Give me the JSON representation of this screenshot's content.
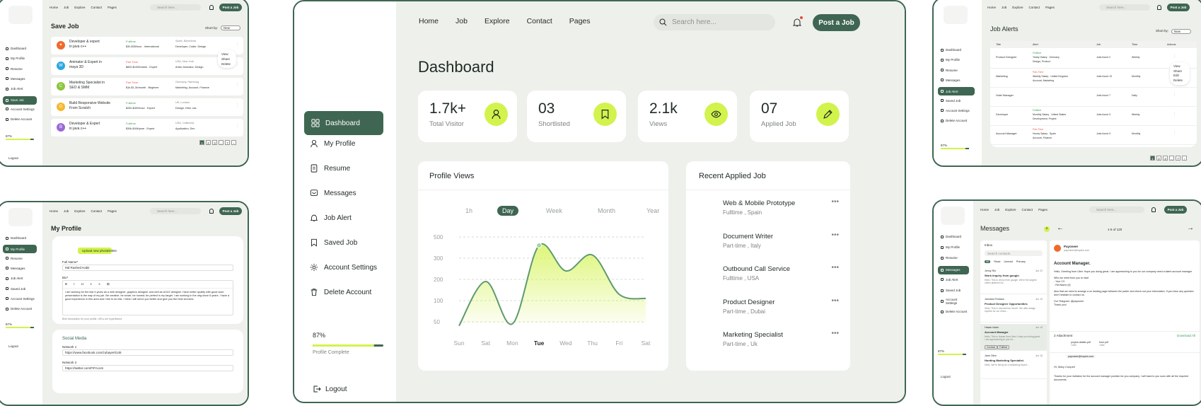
{
  "nav": {
    "home": "Home",
    "job": "Job",
    "explore": "Explore",
    "contact": "Contact",
    "pages": "Pages"
  },
  "search_placeholder": "Search here...",
  "post_job": "Post a Job",
  "center": {
    "title": "Dashboard",
    "sidebar": [
      {
        "label": "Dashboard",
        "icon": "grid-icon"
      },
      {
        "label": "My Profile",
        "icon": "user-icon"
      },
      {
        "label": "Resume",
        "icon": "file-icon"
      },
      {
        "label": "Messages",
        "icon": "chat-icon"
      },
      {
        "label": "Job Alert",
        "icon": "bell-icon"
      },
      {
        "label": "Saved Job",
        "icon": "bookmark-icon"
      },
      {
        "label": "Account Settings",
        "icon": "gear-icon"
      },
      {
        "label": "Delete Account",
        "icon": "trash-icon"
      }
    ],
    "progress": {
      "pct_label": "87%",
      "value": 0.87,
      "label": "Profile Complete"
    },
    "logout": "Logout",
    "stats": [
      {
        "value": "1.7k+",
        "label": "Total Visitor",
        "icon": "user-icon"
      },
      {
        "value": "03",
        "label": "Shortlisted",
        "icon": "bookmark-icon"
      },
      {
        "value": "2.1k",
        "label": "Views",
        "icon": "eye-icon"
      },
      {
        "value": "07",
        "label": "Applied Job",
        "icon": "pencil-icon"
      }
    ],
    "profile_views": {
      "title": "Profile Views",
      "tabs": [
        "1h",
        "Day",
        "Week",
        "Month",
        "Year"
      ],
      "active_tab": "Day"
    },
    "recent": {
      "title": "Recent Applied Job",
      "items": [
        {
          "title": "Web & Mobile Prototype",
          "meta": "Fulltime , Spain"
        },
        {
          "title": "Document Writer",
          "meta": "Part-time , Italy"
        },
        {
          "title": "Outbound Call Service",
          "meta": "Fulltime , USA"
        },
        {
          "title": "Product Designer",
          "meta": "Part-time , Dubai"
        },
        {
          "title": "Marketing Specialist",
          "meta": "Part-time , Uk"
        }
      ]
    }
  },
  "chart_data": {
    "type": "area",
    "categories": [
      "Sun",
      "Sat",
      "Mon",
      "Tue",
      "Wed",
      "Thu",
      "Fri",
      "Sat"
    ],
    "values": [
      30,
      190,
      40,
      420,
      240,
      330,
      130,
      110
    ],
    "yticks": [
      500,
      300,
      200,
      100,
      50
    ],
    "highlight": "Tue",
    "color": "#5e9a6f"
  },
  "save_job": {
    "title": "Save Job",
    "sort_label": "Short by:",
    "sort_value": "New",
    "sidebar": [
      "Dashboard",
      "My Profile",
      "Resume",
      "Messages",
      "Job Alert",
      "Save Job",
      "Account Settings",
      "Delete Account"
    ],
    "active": "Save Job",
    "progress": "87%",
    "progress_value": 0.87,
    "logout": "Logout",
    "rows": [
      {
        "title": "Developer & expert",
        "title2": "in java c++",
        "type": "Fulltime",
        "type_color": "#3fa35a",
        "salary": "$30-$35/hour . International",
        "loc": "Spain, Barcelona",
        "tags": "Developer, Coder, Design",
        "logo_color": "#f06a2a",
        "logo": "✦"
      },
      {
        "title": "Animator & Expert in",
        "title2": "maya 3D",
        "type": "Part Time",
        "type_color": "#e85a4f",
        "salary": "$800-$1000/week . Expert",
        "loc": "USA, New York",
        "tags": "Artist, Animator, Design",
        "logo_color": "#2aa8e0",
        "logo": "W"
      },
      {
        "title": "Marketing Specialist in",
        "title2": "SEO & SMM",
        "type": "Part Time",
        "type_color": "#e85a4f",
        "salary": "$1k-$1.2k/month . Beginner",
        "loc": "Germany, Hamburg",
        "tags": "Marketing, Account, Finance",
        "logo_color": "#8cc63f",
        "logo": "C"
      },
      {
        "title": "Build Responsive Website",
        "title2": "From Scratch",
        "type": "Fulltime",
        "type_color": "#3fa35a",
        "salary": "$260-$400/hour . Expert",
        "loc": "UK, London",
        "tags": "Design, Html, css",
        "logo_color": "#f5b82e",
        "logo": "G"
      },
      {
        "title": "Developer & Expert",
        "title2": "in java c++",
        "type": "Fulltime",
        "type_color": "#3fa35a",
        "salary": "$30k-$40k/year . Expert",
        "loc": "USA, California",
        "tags": "Application, Dev",
        "logo_color": "#9b6ad6",
        "logo": "B"
      }
    ],
    "menu": [
      "View",
      "Share",
      "Delete"
    ],
    "pages": [
      "1",
      "2",
      "3",
      "...",
      "7",
      "›"
    ]
  },
  "my_profile": {
    "title": "My Profile",
    "sidebar": [
      "Dashboard",
      "My Profile",
      "Resume",
      "Messages",
      "Job Alert",
      "Saved Job",
      "Account Settings",
      "Delete Account"
    ],
    "active": "My Profile",
    "upload": "Upload new photo",
    "delete": "Delete",
    "full_name_label": "Full Name*",
    "full_name": "Md Rashed Kabir",
    "bio_label": "Bio*",
    "bio": "I am working for the last 4 years as a web designer, graphics designer and well as UI/UX designer. Have better quality with good work presentation is the way of my job. Be creative, be smart, be honest; be perfect is my target. I am working in the obg since 6 years. I have a good experience in this area and I like to do this. I think I will serve you better and give you the best services.",
    "bio_hint": "Brief description for your profile. URLs are hyperlinked.",
    "progress": "87%",
    "progress_value": 0.87,
    "logout": "Logout",
    "social_title": "Social Media",
    "network1_label": "Network 1",
    "network1": "https://www.facebook.com/zubayer0145",
    "network2_label": "Network 2",
    "network2": "https://twitter.com/FIFAcom"
  },
  "job_alerts": {
    "title": "Job Alerts",
    "sort_label": "Short by:",
    "sort_value": "New",
    "sidebar": [
      "Dashboard",
      "My Profile",
      "Resume",
      "Messages",
      "Job Alert",
      "Saved Job",
      "Account Settings",
      "Delete Account"
    ],
    "active": "Job Alert",
    "progress": "87%",
    "progress_value": 0.87,
    "columns": [
      "Title",
      "Alert",
      "Job",
      "Time",
      "Actions"
    ],
    "rows": [
      {
        "title": "Product Designer",
        "alert_type": "Fulltime",
        "alert_color": "#3fa35a",
        "alert": "Yearly Salary . Germany",
        "alert2": "Design, Product",
        "job": "Jobs found 2",
        "time": "Weekly"
      },
      {
        "title": "Marketing",
        "alert_type": "Part-Time",
        "alert_color": "#e85a4f",
        "alert": "Weekly Salary . United Kingdom",
        "alert2": "Account, Marketing",
        "job": "Jobs found 13",
        "time": "Monthly"
      },
      {
        "title": "Hotel Manager",
        "alert_type": "",
        "alert_color": "#3fa35a",
        "alert": "",
        "alert2": "",
        "job": "Jobs found 7",
        "time": "Daily"
      },
      {
        "title": "Developer",
        "alert_type": "Fulltime",
        "alert_color": "#3fa35a",
        "alert": "Monthly Salary . United States",
        "alert2": "Development, Project",
        "job": "Jobs found 3",
        "time": "Weekly"
      },
      {
        "title": "Account Manager",
        "alert_type": "Part-Time",
        "alert_color": "#e85a4f",
        "alert": "Hourly Salary . Spain",
        "alert2": "Account, Finance",
        "job": "Jobs found 9",
        "time": "Monthly"
      }
    ],
    "menu": [
      "View",
      "Share",
      "Edit",
      "Delete"
    ],
    "pages": [
      "1",
      "2",
      "3",
      "...",
      "7",
      "›"
    ]
  },
  "messages": {
    "title": "Messages",
    "sidebar": [
      "Dashboard",
      "My Profile",
      "Resume",
      "Messages",
      "Job Alert",
      "Saved Job",
      "Account Settings",
      "Delete Account"
    ],
    "active": "Messages",
    "progress": "87%",
    "progress_value": 0.87,
    "logout": "Logout",
    "inbox": "Inbox",
    "search": "Search contacts",
    "filters": [
      "All",
      "Read",
      "Unread",
      "Primary"
    ],
    "pager": "1-5 of 120",
    "list": [
      {
        "name": "Jenny Rio",
        "date": "Jun 20",
        "subject": "Work inquiry from google.",
        "preview": "Hello, This is Jenny from google. We're the largest online platform for..."
      },
      {
        "name": "Jannatul Ferdaus",
        "date": "Jun 19",
        "subject": "Product Designer Opportunities",
        "preview": "Hello, This is Jannat from HuntX. We offer design experts for our direct..."
      },
      {
        "name": "Hasan Islam",
        "date": "Jun 19",
        "subject": "Account Manager",
        "preview": "Hello, This is Hasan from Uber. Hope you doing great. I am appreaching to you for..."
      },
      {
        "name": "Jane Olive",
        "date": "Jun 18",
        "subject": "Hunting Marketing Specialist",
        "preview": "Hello, We're hiring for a marketing expert..."
      }
    ],
    "chips": [
      "Contract",
      "Fulltime"
    ],
    "sender": "Payoneer",
    "sender_email": "payoneer@inquire.com",
    "subject": "Account Manager.",
    "body1": "Hello, Greeting from Uber. Hope you doing great. I am appreaching to you for our company need a talent account manager.",
    "body2": "Who we need from you to start",
    "body3": "- Your CV\n- Ref.Name (if)",
    "body4": "Also that we need to arrange a on landing page between the parter and check out your information. If you have any question don't hesitate to contact us.",
    "body5": "Our Telegram: @payoneer",
    "thanks": "Thank you!",
    "attachment": "2 Attachment",
    "download": "Download All",
    "files": [
      {
        "name": "project-details.pdf",
        "size": "12kb"
      },
      {
        "name": "form.pdf",
        "size": "14kb"
      }
    ],
    "to": "payoneer@inquire.com",
    "reply": "Hi, Mary Cooper!",
    "reply2": "Thanks for your invitation for the account manager position for you company. I will back to you soon with all the required documents."
  }
}
